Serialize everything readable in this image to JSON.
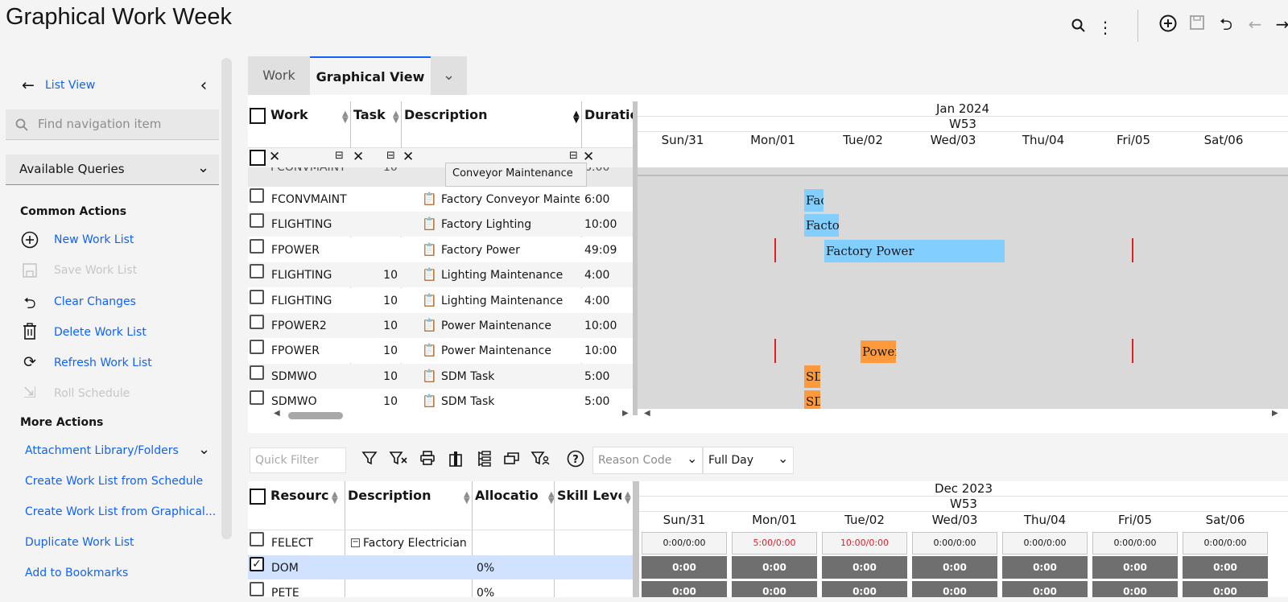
{
  "app": {
    "title": "Graphical Work Week"
  },
  "toolbar": {
    "search_icon": "search-icon",
    "more_icon": "overflow-menu-icon",
    "add_icon": "add-icon",
    "save_icon": "save-icon",
    "undo_icon": "undo-icon",
    "back_icon": "arrow-left-icon",
    "forward_icon": "arrow-right-icon"
  },
  "sidebar": {
    "back_label": "List View",
    "search_placeholder": "Find navigation item",
    "queries_label": "Available Queries",
    "common_header": "Common Actions",
    "common": [
      {
        "label": "New Work List",
        "icon": "add-circle-icon",
        "disabled": false
      },
      {
        "label": "Save Work List",
        "icon": "save-icon",
        "disabled": true
      },
      {
        "label": "Clear Changes",
        "icon": "undo-icon",
        "disabled": false
      },
      {
        "label": "Delete Work List",
        "icon": "trash-icon",
        "disabled": false
      },
      {
        "label": "Refresh Work List",
        "icon": "refresh-icon",
        "disabled": false
      },
      {
        "label": "Roll Schedule",
        "icon": "export-icon",
        "disabled": true
      }
    ],
    "more_header": "More Actions",
    "more": [
      {
        "label": "Attachment Library/Folders"
      },
      {
        "label": "Create Work List from Schedule"
      },
      {
        "label": "Create Work List from Graphical..."
      },
      {
        "label": "Duplicate Work List"
      },
      {
        "label": "Add to Bookmarks"
      }
    ]
  },
  "tabs": [
    {
      "label": "Work",
      "active": false
    },
    {
      "label": "Graphical View",
      "active": true
    }
  ],
  "work_grid": {
    "columns": [
      "Work",
      "Task",
      "Description",
      "Duratio"
    ],
    "filter_clear": "✕",
    "partial_row": {
      "work": "FCONVMAINT",
      "task": "10",
      "desc": "Conveyor Maintenance",
      "dur": "6:00"
    },
    "rows": [
      {
        "work": "FCONVMAINT",
        "task": "",
        "desc": "Factory Conveyor Mainten",
        "dur": "6:00"
      },
      {
        "work": "FLIGHTING",
        "task": "",
        "desc": "Factory Lighting",
        "dur": "10:00"
      },
      {
        "work": "FPOWER",
        "task": "",
        "desc": "Factory Power",
        "dur": "49:09"
      },
      {
        "work": "FLIGHTING",
        "task": "10",
        "desc": "Lighting Maintenance",
        "dur": "4:00"
      },
      {
        "work": "FLIGHTING",
        "task": "10",
        "desc": "Lighting Maintenance",
        "dur": "4:00"
      },
      {
        "work": "FPOWER2",
        "task": "10",
        "desc": "Power Maintenance",
        "dur": "10:00"
      },
      {
        "work": "FPOWER",
        "task": "10",
        "desc": "Power Maintenance",
        "dur": "10:00"
      },
      {
        "work": "SDMWO",
        "task": "10",
        "desc": "SDM Task",
        "dur": "5:00"
      },
      {
        "work": "SDMWO",
        "task": "10",
        "desc": "SDM Task",
        "dur": "5:00"
      }
    ]
  },
  "gantt": {
    "month": "Jan 2024",
    "week": "W53",
    "days": [
      "Sun/31",
      "Mon/01",
      "Tue/02",
      "Wed/03",
      "Thu/04",
      "Fri/05",
      "Sat/06"
    ],
    "bars": [
      {
        "label": "Fac",
        "color": "#82cfff"
      },
      {
        "label": "Factor",
        "color": "#82cfff"
      },
      {
        "label": "Factory Power",
        "color": "#82cfff"
      },
      {
        "label": "Power",
        "color": "#ff9a3c"
      },
      {
        "label": "SD",
        "color": "#ff9a3c"
      },
      {
        "label": "SD",
        "color": "#ff9a3c"
      }
    ]
  },
  "bottom_toolbar": {
    "quick_filter_placeholder": "Quick Filter",
    "reason_placeholder": "Reason Code",
    "range_value": "Full Day"
  },
  "resource_grid": {
    "columns": [
      "Resourc",
      "Description",
      "Allocatio",
      "Skill Leve"
    ],
    "rows": [
      {
        "resource": "FELECT",
        "desc": "Factory Electrician",
        "alloc": "",
        "checked": false,
        "selected": false
      },
      {
        "resource": "DOM",
        "desc": "",
        "alloc": "0%",
        "checked": true,
        "selected": true
      },
      {
        "resource": "PETE",
        "desc": "",
        "alloc": "0%",
        "checked": false,
        "selected": false
      }
    ]
  },
  "capacity": {
    "month": "Dec 2023",
    "week": "W53",
    "days": [
      "Sun/31",
      "Mon/01",
      "Tue/02",
      "Wed/03",
      "Thu/04",
      "Fri/05",
      "Sat/06"
    ],
    "summary": [
      "0:00/0:00",
      "5:00/0:00",
      "10:00/0:00",
      "0:00/0:00",
      "0:00/0:00",
      "0:00/0:00",
      "0:00/0:00"
    ],
    "summary_red": [
      false,
      true,
      true,
      false,
      false,
      false,
      false
    ],
    "row_dom": [
      "0:00",
      "0:00",
      "0:00",
      "0:00",
      "0:00",
      "0:00",
      "0:00"
    ],
    "row_pete": [
      "0:00",
      "0:00",
      "0:00",
      "0:00",
      "0:00",
      "0:00",
      "0:00"
    ]
  }
}
